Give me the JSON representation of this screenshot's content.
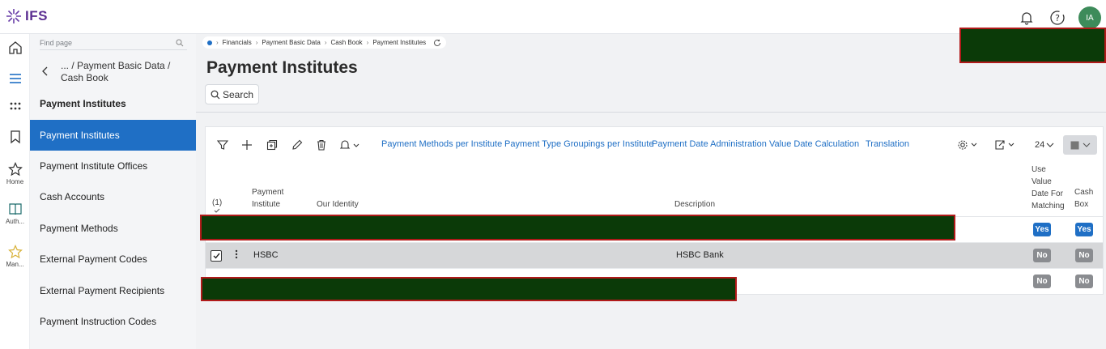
{
  "app": {
    "logo_text": "IFS",
    "avatar_initials": "IA"
  },
  "rail": [
    {
      "name": "home-icon"
    },
    {
      "name": "menu-icon"
    },
    {
      "name": "apps-grid-icon"
    },
    {
      "name": "bookmark-icon"
    },
    {
      "name": "star-icon",
      "label": "Home"
    },
    {
      "name": "book-icon",
      "label": "Auth..."
    },
    {
      "name": "star-outline-icon",
      "label": "Man..."
    }
  ],
  "sidenav": {
    "find_placeholder": "Find page",
    "crumb": "... / Payment Basic Data / Cash Book",
    "heading": "Payment Institutes",
    "items": [
      {
        "label": "Payment Institutes",
        "active": true
      },
      {
        "label": "Payment Institute Offices"
      },
      {
        "label": "Cash Accounts"
      },
      {
        "label": "Payment Methods"
      },
      {
        "label": "External Payment Codes"
      },
      {
        "label": "External Payment Recipients"
      },
      {
        "label": "Payment Instruction Codes"
      }
    ]
  },
  "breadcrumb": [
    "Financials",
    "Payment Basic Data",
    "Cash Book",
    "Payment Institutes"
  ],
  "page": {
    "title": "Payment Institutes",
    "search_label": "Search"
  },
  "toolbar": {
    "links": [
      "Payment Methods per Institute",
      "Payment Type Groupings per Institute",
      "Payment Date Administration",
      "Value Date Calculation",
      "Translation"
    ],
    "page_size": "24"
  },
  "table": {
    "selection_count": "(1)",
    "headers": {
      "institute": [
        "Payment",
        "Institute"
      ],
      "identity": "Our Identity",
      "description": "Description",
      "use_value_date": [
        "Use",
        "Value",
        "Date For",
        "Matching"
      ],
      "cash_box": [
        "Cash",
        "Box"
      ]
    },
    "rows": [
      {
        "institute": "",
        "description": "",
        "use_value_date": "Yes",
        "cash_box": "Yes",
        "selected": false
      },
      {
        "institute": "HSBC",
        "description": "HSBC Bank",
        "use_value_date": "No",
        "cash_box": "No",
        "selected": true
      },
      {
        "institute": "",
        "description": "",
        "use_value_date": "No",
        "cash_box": "No",
        "selected": false
      }
    ]
  },
  "colors": {
    "accent": "#1f6fc5",
    "brand": "#5b2e91",
    "redaction": "#0b3a08"
  }
}
